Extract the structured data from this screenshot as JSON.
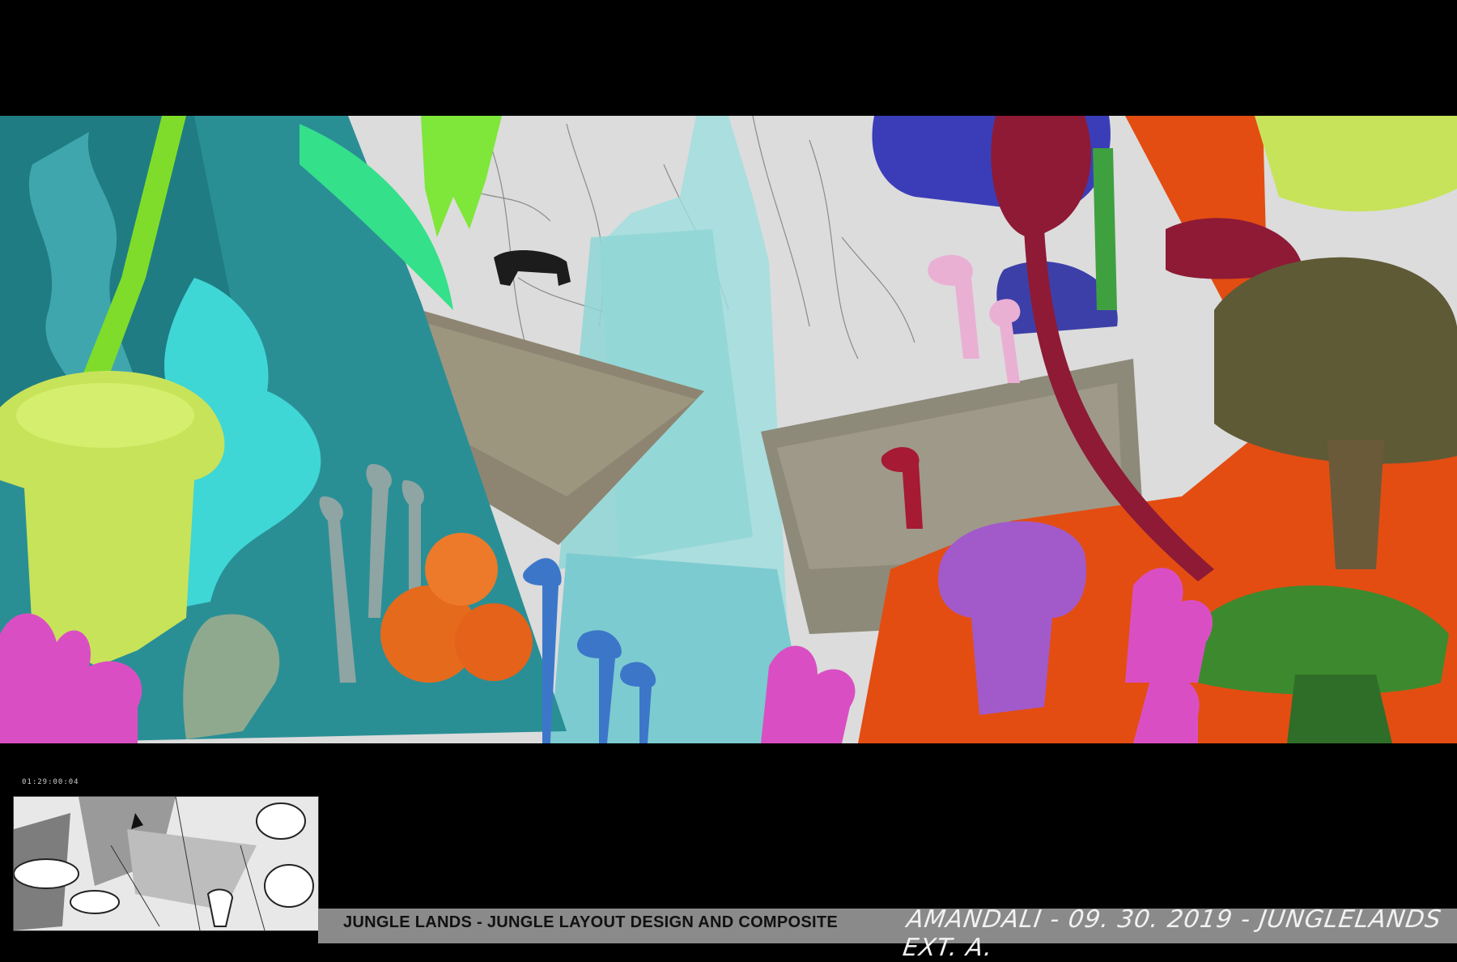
{
  "viewer": {
    "timecode": "01:29:00:04",
    "caption": "JUNGLE LANDS - JUNGLE LAYOUT DESIGN AND COMPOSITE",
    "signature": "AMANDALI - 09. 30. 2019 - JUNGLELANDS EXT. A."
  },
  "colors": {
    "teal": "#2a8f95",
    "cyan": "#3fd6d6",
    "lime": "#c7e35a",
    "orange": "#e34d12",
    "purple": "#a25acb",
    "crimson": "#8e1a36",
    "olive": "#5f5a36",
    "green": "#3d8a2e",
    "blue": "#3b3db8",
    "magenta": "#d94fc3"
  }
}
